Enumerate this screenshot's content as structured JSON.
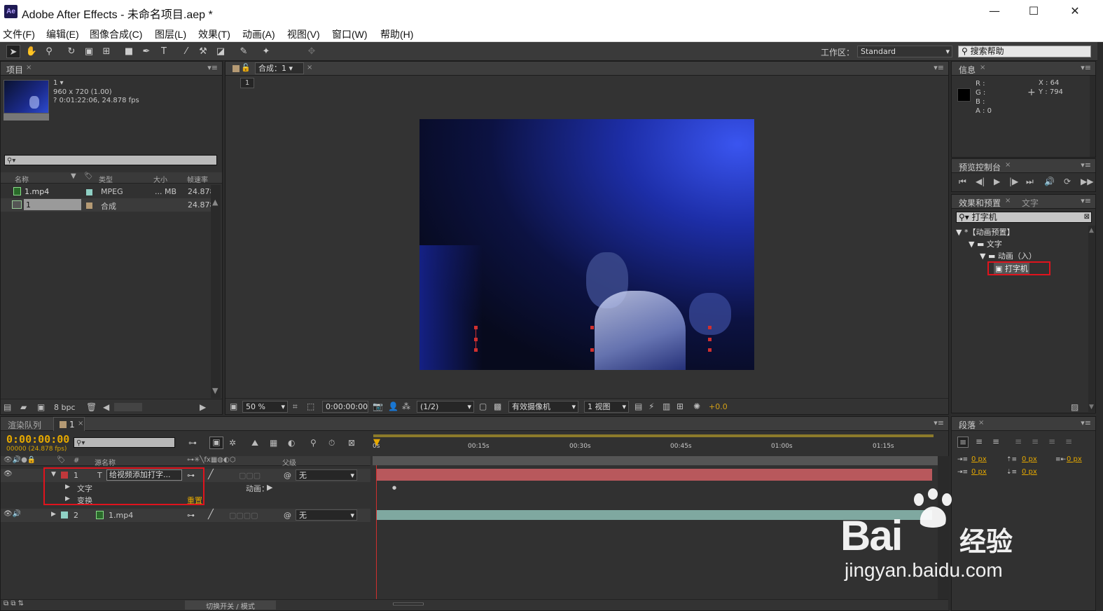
{
  "window": {
    "title": "Adobe After Effects - 未命名项目.aep *",
    "logo": "Ae",
    "controls": [
      "minimize-icon",
      "maximize-icon",
      "close-icon"
    ]
  },
  "menu": [
    "文件(F)",
    "编辑(E)",
    "图像合成(C)",
    "图层(L)",
    "效果(T)",
    "动画(A)",
    "视图(V)",
    "窗口(W)",
    "帮助(H)"
  ],
  "toolbar": {
    "workspace_label": "工作区：",
    "workspace_value": "Standard",
    "help_placeholder": "搜索帮助"
  },
  "project": {
    "tab": "项目",
    "comp_name": "1",
    "comp_size": "960 x 720 (1.00)",
    "comp_duration": "? 0:01:22:06, 24.878 fps",
    "columns": [
      "名称",
      "类型",
      "大小",
      "帧速率"
    ],
    "rows": [
      {
        "name": "1.mp4",
        "type": "MPEG",
        "size": "... MB",
        "fps": "24.878",
        "color": "#8fd0c4"
      },
      {
        "name": "1",
        "type": "合成",
        "size": "",
        "fps": "24.878",
        "color": "#b59a74"
      }
    ],
    "bpc": "8 bpc"
  },
  "composition": {
    "tab": "合成：1",
    "flow_label": "1",
    "zoom": "50 %",
    "timecode": "0:00:00:00",
    "resolution": "(1/2)",
    "camera": "有效摄像机",
    "views": "1 视图",
    "exposure": "+0.0"
  },
  "info": {
    "tab": "信息",
    "r": "R :",
    "g": "G :",
    "b": "B :",
    "a": "A : 0",
    "x": "X : 64",
    "y": "Y : 794"
  },
  "preview": {
    "tab": "预览控制台"
  },
  "effects": {
    "tab": "效果和预置",
    "tab2": "文字",
    "search": "打字机",
    "tree": [
      {
        "label": "*【动画预置】",
        "level": 0
      },
      {
        "label": "文字",
        "level": 1
      },
      {
        "label": "动画（入）",
        "level": 2
      },
      {
        "label": "打字机",
        "level": 3
      }
    ]
  },
  "paragraph": {
    "tab": "段落",
    "px1": "0 px",
    "px2": "0 px",
    "px3": "0 px",
    "px4": "0 px",
    "px5": "0 px"
  },
  "timeline": {
    "tab1": "渲染队列",
    "tab2": "1",
    "timecode": "0:00:00:00",
    "fps_line": "00000 (24.878 fps)",
    "columns": {
      "num": "#",
      "name": "源名称",
      "parent": "父级"
    },
    "ruler": [
      "0s",
      "00:15s",
      "00:30s",
      "00:45s",
      "01:00s",
      "01:15s"
    ],
    "layers": [
      {
        "num": "1",
        "name": "给视频添加打字...",
        "parent": "无",
        "color": "#c2383b"
      },
      {
        "num": "2",
        "name": "1.mp4",
        "parent": "无",
        "color": "#8fd0c4"
      }
    ],
    "sub": {
      "text": "文字",
      "transform": "变换",
      "animate": "动画：",
      "reset": "重置"
    },
    "footer": "切换开关 / 模式"
  },
  "watermark": {
    "brand": "Bai",
    "brand2": "经验",
    "url": "jingyan.baidu.com"
  }
}
